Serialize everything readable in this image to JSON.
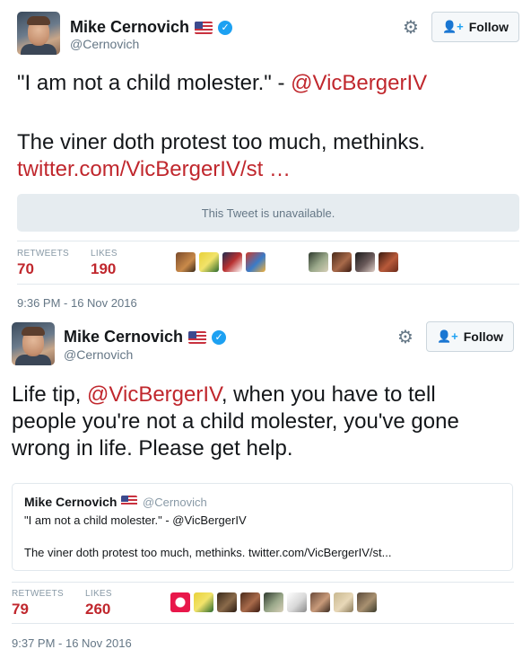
{
  "tweets": [
    {
      "author_name": "Mike Cernovich",
      "handle": "@Cernovich",
      "follow_label": "Follow",
      "text_line1_prefix": "\"I am not a child molester.\" - ",
      "text_line1_mention": "@VicBergerIV",
      "text_line2": "The viner doth protest too much, methinks.",
      "text_line3_link": "twitter.com/VicBergerIV/st …",
      "unavailable_text": "This Tweet is unavailable.",
      "retweets_label": "RETWEETS",
      "retweets_count": "70",
      "likes_label": "LIKES",
      "likes_count": "190",
      "timestamp": "9:36 PM - 16 Nov 2016"
    },
    {
      "author_name": "Mike Cernovich",
      "handle": "@Cernovich",
      "follow_label": "Follow",
      "text_line1_prefix": "Life tip, ",
      "text_line1_mention": "@VicBergerIV",
      "text_line1_suffix": ", when you have to tell",
      "text_line2": "people you're not a child molester, you've gone",
      "text_line3": "wrong in life. Please get help.",
      "quote": {
        "name": "Mike Cernovich",
        "handle": "@Cernovich",
        "line1": "\"I am not a child molester.\" - @VicBergerIV",
        "line2": "The viner doth protest too much, methinks. twitter.com/VicBergerIV/st..."
      },
      "retweets_label": "RETWEETS",
      "retweets_count": "79",
      "likes_label": "LIKES",
      "likes_count": "260",
      "timestamp": "9:37 PM - 16 Nov 2016"
    }
  ],
  "colors": {
    "accent_link": "#c0272d",
    "verified_blue": "#1da1f2",
    "muted_text": "#657786"
  },
  "icons": [
    "gear-icon",
    "follow-person-plus-icon",
    "verified-badge-icon",
    "us-flag-icon"
  ]
}
